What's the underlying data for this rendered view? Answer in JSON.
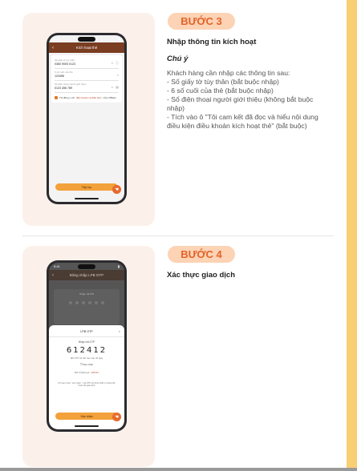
{
  "step1": {
    "badge": "BƯỚC 3",
    "title": "Nhập thông tin kích hoạt",
    "note_label": "Chú ý",
    "lines": [
      "Khách hàng cần nhập các thông tin sau:",
      "- Số giấy tờ tùy thân (bắt buộc nhập)",
      "- 6 số cuối của thẻ (bắt buộc nhập)",
      "- Số điện thoại người giới thiệu (không bắt buộc nhập)",
      "- Tích vào ô \"Tôi cam kết đã đọc và hiểu nội dung điều kiện điều khoản kích hoạt thẻ\" (bắt buộc)"
    ],
    "phone": {
      "time": "9:41",
      "screen_title": "Kích hoạt thẻ",
      "fields": [
        {
          "label": "Số giấy tờ tùy thân",
          "value": "0360 9000 0123"
        },
        {
          "label": "6 số cuối của thẻ",
          "value": "123456"
        },
        {
          "label": "Số điện thoại người giới thiệu",
          "value": "0123 456 789"
        }
      ],
      "consent_prefix": "Tôi đồng ý với",
      "consent_link": "điều khoản và điều kiện",
      "consent_suffix": "của LPBank",
      "cta": "Tiếp tục"
    }
  },
  "step2": {
    "badge": "BƯỚC 4",
    "title": "Xác thực giao dịch",
    "phone": {
      "time": "9:41",
      "screen_title": "Đăng nhập LPB OTP",
      "bg_prompt": "Nhập mã PIN",
      "sheet_title": "LPB OTP",
      "otp_label": "Nhập mã OTP",
      "otp_code": "612412",
      "timer": "Mã OTP sẽ hết hạn sau 30 giây",
      "copy": "Sao chép",
      "challenge_label": "Mã Challenge:",
      "challenge_value": "123141",
      "note": "Khi bạn chọn \"xác nhận\", mã OTP sẽ được điền tự động để hoàn tất giao dịch",
      "cta": "Xác nhận"
    }
  }
}
